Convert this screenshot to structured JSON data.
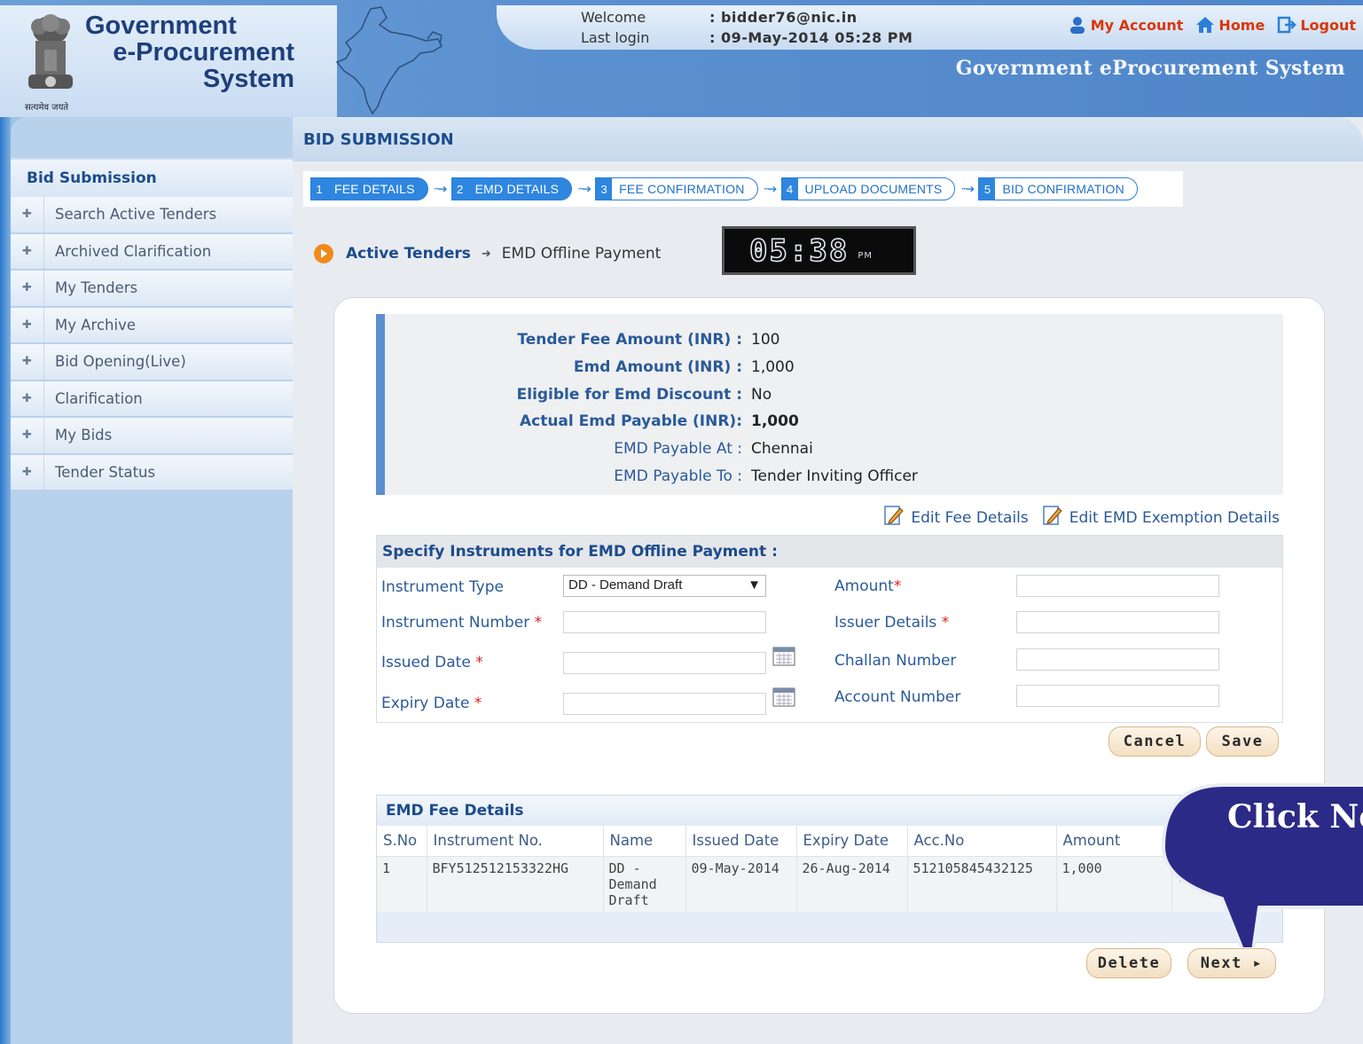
{
  "header": {
    "logo_line1": "Government",
    "logo_line2": "e-Procurement",
    "logo_line3": "System",
    "tagline": "सत्यमेव जयते",
    "welcome_label": "Welcome",
    "welcome_value": ": bidder76@nic.in",
    "last_login_label": "Last login",
    "last_login_value": ": 09-May-2014 05:28 PM",
    "links": {
      "my_account": "My Account",
      "home": "Home",
      "logout": "Logout"
    },
    "system_title": "Government eProcurement System"
  },
  "sidebar": {
    "section": "Bid Submission",
    "items": [
      {
        "label": "Search Active Tenders"
      },
      {
        "label": "Archived Clarification"
      },
      {
        "label": "My Tenders"
      },
      {
        "label": "My Archive"
      },
      {
        "label": "Bid Opening(Live)"
      },
      {
        "label": "Clarification"
      },
      {
        "label": "My Bids"
      },
      {
        "label": "Tender Status"
      }
    ]
  },
  "page": {
    "title": "BID SUBMISSION",
    "steps": [
      {
        "num": "1",
        "label": "FEE DETAILS",
        "active": true
      },
      {
        "num": "2",
        "label": "EMD DETAILS",
        "active": true
      },
      {
        "num": "3",
        "label": "FEE CONFIRMATION",
        "active": false
      },
      {
        "num": "4",
        "label": "UPLOAD DOCUMENTS",
        "active": false
      },
      {
        "num": "5",
        "label": "BID CONFIRMATION",
        "active": false
      }
    ],
    "breadcrumb": {
      "parent": "Active Tenders",
      "current": "EMD Offline Payment"
    },
    "clock": {
      "time": "05:38",
      "ampm": "PM"
    }
  },
  "summary": {
    "tender_fee_label": "Tender Fee Amount (INR) :",
    "tender_fee_value": "100",
    "emd_amount_label": "Emd Amount (INR) :",
    "emd_amount_value": "1,000",
    "eligible_label": "Eligible for Emd Discount :",
    "eligible_value": "No",
    "actual_label": "Actual Emd Payable (INR):",
    "actual_value": "1,000",
    "payable_at_label": "EMD Payable At :",
    "payable_at_value": "Chennai",
    "payable_to_label": "EMD Payable To :",
    "payable_to_value": "Tender Inviting Officer"
  },
  "edit_links": {
    "fee": "Edit Fee Details",
    "emd": "Edit EMD Exemption Details"
  },
  "form": {
    "header": "Specify Instruments for EMD Offline Payment :",
    "instrument_type_label": "Instrument Type",
    "instrument_type_value": "DD - Demand Draft",
    "instrument_number_label": "Instrument Number",
    "issued_date_label": "Issued Date",
    "expiry_date_label": "Expiry Date",
    "amount_label": "Amount",
    "issuer_label": "Issuer Details",
    "challan_label": "Challan Number",
    "account_label": "Account Number",
    "cancel": "Cancel",
    "save": "Save"
  },
  "emd_grid": {
    "title": "EMD Fee Details",
    "columns": [
      "S.No",
      "Instrument No.",
      "Name",
      "Issued Date",
      "Expiry Date",
      "Acc.No",
      "Amount"
    ],
    "rows": [
      {
        "sno": "1",
        "instrument_no": "BFY512512153322HG",
        "name": "DD - Demand Draft",
        "issued": "09-May-2014",
        "expiry": "26-Aug-2014",
        "acc_no": "512105845432125",
        "amount": "1,000"
      }
    ],
    "delete": "Delete",
    "next": "Next"
  },
  "callout": {
    "text": "Click Ne"
  },
  "colors": {
    "accent": "#1d4c8c",
    "header_bg": "#5b90d0",
    "step_blue": "#2f86e0",
    "callout": "#2b2a86"
  }
}
